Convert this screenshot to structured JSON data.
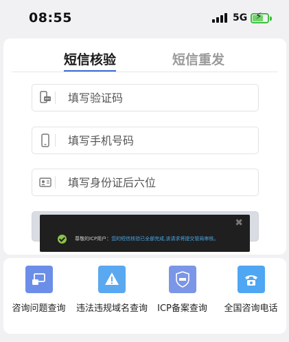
{
  "status_bar": {
    "time": "08:55",
    "network": "5G",
    "bolt": "⚡"
  },
  "tabs": [
    {
      "label": "短信核验",
      "active": true
    },
    {
      "label": "短信重发",
      "active": false
    }
  ],
  "form": {
    "verify_code": {
      "placeholder": "填写验证码",
      "icon": "sms-icon"
    },
    "phone": {
      "placeholder": "填写手机号码",
      "icon": "phone-icon"
    },
    "id_last_six": {
      "placeholder": "填写身份证后六位",
      "icon": "id-card-icon"
    }
  },
  "toast": {
    "close": "✖",
    "prefix": "尊敬的ICP用户：",
    "message": "您的短信核验已全部完成,该请求将提交管局审核。"
  },
  "quick_links": [
    {
      "label": "咨询问题查询",
      "icon": "chat-query-icon",
      "color": "#6b8ee8"
    },
    {
      "label": "违法违规域名查询",
      "icon": "warning-icon",
      "color": "#5aa8f0"
    },
    {
      "label": "ICP备案查询",
      "icon": "icp-shield-icon",
      "color": "#7b96e6"
    },
    {
      "label": "全国咨询电话",
      "icon": "telephone-icon",
      "color": "#4fa6f2"
    }
  ]
}
